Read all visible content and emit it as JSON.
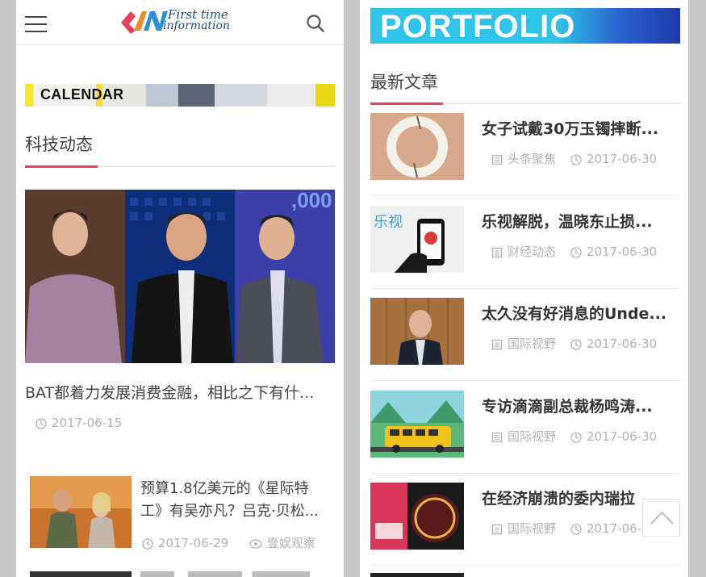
{
  "left": {
    "logo": {
      "line1": "First time",
      "line2": "information"
    },
    "banner_text": "CALENDAR",
    "section_title": "科技动态",
    "feature": {
      "title": "BAT都着力发展消费金融，相比之下有什...",
      "date": "2017-06-15"
    },
    "item": {
      "title": "预算1.8亿美元的《星际特工》有吴亦凡？吕克·贝松...",
      "date": "2017-06-29",
      "category": "壹娱观察"
    }
  },
  "right": {
    "banner_text": "PORTFOLIO",
    "section_title": "最新文章",
    "articles": [
      {
        "title": "女子试戴30万玉镯摔断...",
        "category": "头条聚焦",
        "date": "2017-06-30"
      },
      {
        "title": "乐视解脱，温晓东止损...",
        "category": "财经动态",
        "date": "2017-06-30"
      },
      {
        "title": "太久没有好消息的Unde...",
        "category": "国际视野",
        "date": "2017-06-30"
      },
      {
        "title": "专访滴滴副总裁杨鸣涛...",
        "category": "国际视野",
        "date": "2017-06-30"
      },
      {
        "title": "在经济崩溃的委内瑞拉",
        "category": "国际视野",
        "date": "2017-06-"
      }
    ],
    "image_text": {
      "leshi": "乐视"
    }
  },
  "colors": {
    "accent": "#e8425a",
    "meta": "#b2b2b2",
    "title": "#333333"
  }
}
